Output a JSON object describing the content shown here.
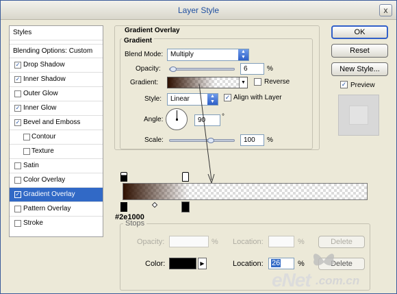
{
  "window": {
    "title": "Layer Style",
    "close_label": "x"
  },
  "sidebar": {
    "items": [
      {
        "label": "Styles",
        "checked": null
      },
      {
        "label": "Blending Options: Custom",
        "checked": null
      },
      {
        "label": "Drop Shadow",
        "checked": true
      },
      {
        "label": "Inner Shadow",
        "checked": true
      },
      {
        "label": "Outer Glow",
        "checked": false
      },
      {
        "label": "Inner Glow",
        "checked": true
      },
      {
        "label": "Bevel and Emboss",
        "checked": true
      },
      {
        "label": "Contour",
        "checked": false
      },
      {
        "label": "Texture",
        "checked": false
      },
      {
        "label": "Satin",
        "checked": false
      },
      {
        "label": "Color Overlay",
        "checked": false
      },
      {
        "label": "Gradient Overlay",
        "checked": true,
        "selected": true
      },
      {
        "label": "Pattern Overlay",
        "checked": false
      },
      {
        "label": "Stroke",
        "checked": false
      }
    ]
  },
  "gradient_overlay": {
    "panel_title": "Gradient Overlay",
    "group_title": "Gradient",
    "blend_mode_label": "Blend Mode:",
    "blend_mode_value": "Multiply",
    "opacity_label": "Opacity:",
    "opacity_value": "6",
    "opacity_unit": "%",
    "opacity_fraction": 0.06,
    "gradient_label": "Gradient:",
    "reverse_label": "Reverse",
    "reverse_checked": false,
    "style_label": "Style:",
    "style_value": "Linear",
    "align_label": "Align with Layer",
    "align_checked": true,
    "angle_label": "Angle:",
    "angle_value": "90",
    "angle_unit": "°",
    "scale_label": "Scale:",
    "scale_value": "100",
    "scale_unit": "%",
    "scale_fraction": 0.4
  },
  "buttons": {
    "ok": "OK",
    "reset": "Reset",
    "new_style": "New Style...",
    "preview_label": "Preview",
    "preview_checked": true
  },
  "gradient_editor": {
    "color_hex_label": "#2e1000",
    "stops_title": "Stops",
    "opacity_label": "Opacity:",
    "opacity_unit": "%",
    "location_label": "Location:",
    "location_unit": "%",
    "delete_label": "Delete",
    "color_label": "Color:",
    "color_location_label": "Location:",
    "color_location_value": "26",
    "color_location_unit": "%",
    "color_delete_label": "Delete",
    "stop_color": "#2e1000",
    "midpoint_fraction": 0.13,
    "stop_fraction": 0.26
  },
  "watermark": {
    "text_main": "eNet",
    "text_suffix": ".com.cn"
  }
}
